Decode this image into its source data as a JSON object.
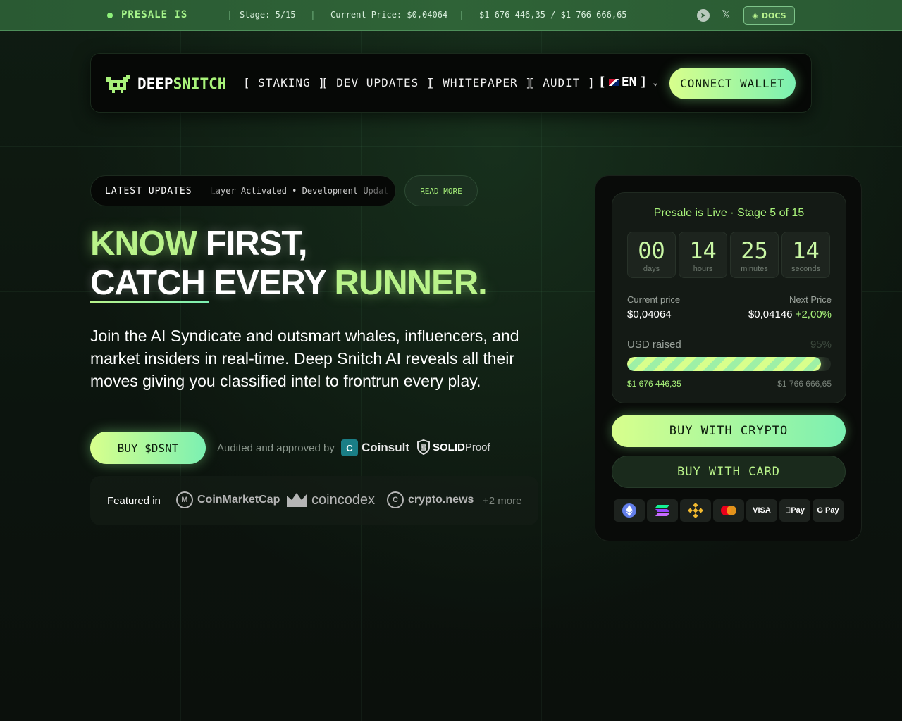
{
  "topbar": {
    "presale_label": "PRESALE IS",
    "stage": "Stage: 5/15",
    "current_price": "Current Price: $0,04064",
    "raised": "$1 676 446,35 / $1 766 666,65",
    "docs_label": "DOCS"
  },
  "nav": {
    "logo_white": "DEEP",
    "logo_green": "SNITCH",
    "links": [
      "[ STAKING ]",
      "[ DEV UPDATES ]",
      "[ WHITEPAPER ]",
      "[ AUDIT ]"
    ],
    "lang_open": "[",
    "lang": "EN",
    "lang_close": "]",
    "connect_label": "CONNECT WALLET"
  },
  "updates": {
    "label": "LATEST UPDATES",
    "ticker": "Layer Activated • Development Updat",
    "read_more": "READ MORE"
  },
  "hero": {
    "line1_green": "KNOW",
    "line1_white": "FIRST,",
    "line2_white": "CATCH EVERY",
    "line2_green": "RUNNER.",
    "description": "Join the AI Syndicate and outsmart whales, influencers, and market insiders in real-time. Deep Snitch AI reveals all their moves giving you classified intel to frontrun every play.",
    "buy_label": "BUY $DSNT",
    "audited_label": "Audited and approved by",
    "auditor1": "Coinsult",
    "auditor2_bold": "SOLID",
    "auditor2_rest": "Proof"
  },
  "featured": {
    "label": "Featured in",
    "brands": [
      "CoinMarketCap",
      "coincodex",
      "crypto.news"
    ],
    "more": "+2 more"
  },
  "presale": {
    "status": "Presale is Live · Stage 5 of 15",
    "countdown": [
      {
        "value": "00",
        "unit": "days"
      },
      {
        "value": "14",
        "unit": "hours"
      },
      {
        "value": "25",
        "unit": "minutes"
      },
      {
        "value": "14",
        "unit": "seconds"
      }
    ],
    "current_price_label": "Current price",
    "current_price": "$0,04064",
    "next_price_label": "Next Price",
    "next_price": "$0,04146",
    "next_price_change": "+2,00%",
    "usd_raised_label": "USD raised",
    "percent": "95%",
    "progress": 0.95,
    "raised": "$1 676 446,35",
    "goal": "$1 766 666,65",
    "buy_crypto_label": "BUY WITH CRYPTO",
    "buy_card_label": "BUY WITH CARD",
    "payment_methods": [
      "ethereum",
      "solana",
      "bnb",
      "mastercard",
      "VISA",
      "Pay",
      "G Pay"
    ]
  },
  "colors": {
    "accent": "#a8f27a",
    "accent_gradient_end": "#7bf0b2",
    "background": "#0c130d"
  }
}
